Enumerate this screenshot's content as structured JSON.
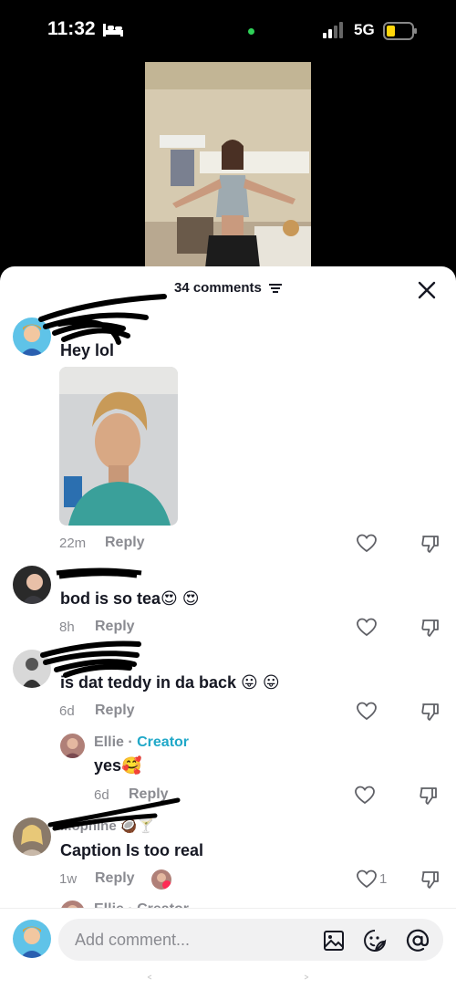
{
  "status_bar": {
    "time": "11:32",
    "network": "5G"
  },
  "comments_header": {
    "title": "34 comments"
  },
  "comments": [
    {
      "text": "Hey lol",
      "time": "22m",
      "reply": "Reply"
    },
    {
      "text": "bod is so tea😍 😍",
      "time": "8h",
      "reply": "Reply"
    },
    {
      "text": "is dat teddy in da back 😛 😛",
      "time": "6d",
      "reply": "Reply"
    },
    {
      "text": "Caption Is too real",
      "time": "1w",
      "reply": "Reply",
      "likes": "1"
    }
  ],
  "creator_reply": {
    "name": "Ellie",
    "separator": " · ",
    "tag": "Creator",
    "text": "yes🥰",
    "time": "6d",
    "reply": "Reply"
  },
  "partial_commenter": "...ophine 🥥🍸",
  "next_creator_peek": "Ellie · Creator",
  "input": {
    "placeholder": "Add comment..."
  },
  "colors": {
    "creator_tag": "#20a8c8",
    "muted": "#8a8b91",
    "text": "#161823"
  }
}
